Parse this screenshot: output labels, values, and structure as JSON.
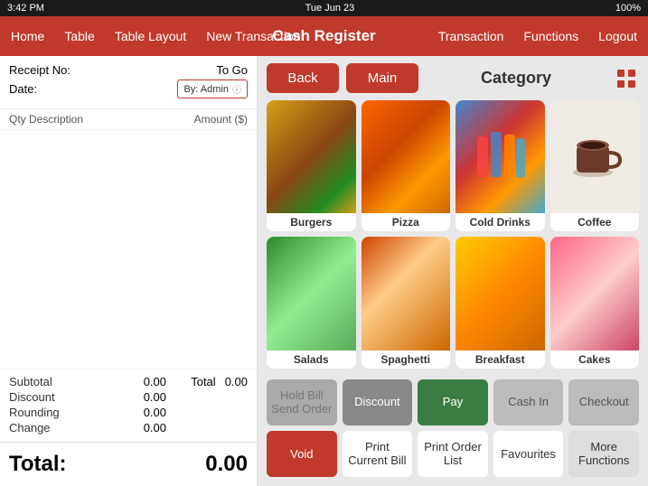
{
  "statusBar": {
    "time": "3:42 PM",
    "date": "Tue Jun 23",
    "battery": "100%",
    "batteryIcon": "battery-full"
  },
  "navBar": {
    "title": "Cash Register",
    "leftItems": [
      "Home",
      "Table",
      "Table Layout",
      "New Transaction"
    ],
    "rightItems": [
      "Transaction",
      "Functions",
      "Logout"
    ]
  },
  "leftPanel": {
    "receiptNo": "Receipt No:",
    "toGo": "To Go",
    "date": "Date:",
    "byAdmin": "By: Admin",
    "colQty": "Qty",
    "colDesc": "Description",
    "colAmount": "Amount ($)",
    "subtotalLabel": "Subtotal",
    "subtotalValue": "0.00",
    "discountLabel": "Discount",
    "discountValue": "0.00",
    "roundingLabel": "Rounding",
    "roundingValue": "0.00",
    "changeLabel": "Change",
    "changeValue": "0.00",
    "totalLabel": "Total",
    "totalValue": "0.00",
    "grandTotalLabel": "Total:",
    "grandTotalValue": "0.00"
  },
  "rightPanel": {
    "backBtn": "Back",
    "mainBtn": "Main",
    "categoryTitle": "Category",
    "categories": [
      {
        "id": "burgers",
        "label": "Burgers",
        "colorClass": "food-burger"
      },
      {
        "id": "pizza",
        "label": "Pizza",
        "colorClass": "food-pizza"
      },
      {
        "id": "cold-drinks",
        "label": "Cold Drinks",
        "colorClass": "food-cold-drinks"
      },
      {
        "id": "coffee",
        "label": "Coffee",
        "colorClass": "food-coffee"
      },
      {
        "id": "salads",
        "label": "Salads",
        "colorClass": "food-salads"
      },
      {
        "id": "spaghetti",
        "label": "Spaghetti",
        "colorClass": "food-spaghetti"
      },
      {
        "id": "breakfast",
        "label": "Breakfast",
        "colorClass": "food-breakfast"
      },
      {
        "id": "cakes",
        "label": "Cakes",
        "colorClass": "food-cakes"
      }
    ],
    "bottomRow1": [
      {
        "id": "hold-bill",
        "label": "Hold Bill\nSend Order",
        "style": "gray"
      },
      {
        "id": "discount",
        "label": "Discount",
        "style": "dark-gray"
      },
      {
        "id": "pay",
        "label": "Pay",
        "style": "green"
      },
      {
        "id": "cash-in",
        "label": "Cash In",
        "style": "light-gray"
      },
      {
        "id": "checkout",
        "label": "Checkout",
        "style": "light-gray"
      }
    ],
    "bottomRow2": [
      {
        "id": "void",
        "label": "Void",
        "style": "red"
      },
      {
        "id": "print-current-bill",
        "label": "Print Current Bill",
        "style": "white"
      },
      {
        "id": "print-order-list",
        "label": "Print Order List",
        "style": "white"
      },
      {
        "id": "favourites",
        "label": "Favourites",
        "style": "white"
      },
      {
        "id": "more-functions",
        "label": "More Functions",
        "style": "outline"
      }
    ]
  }
}
